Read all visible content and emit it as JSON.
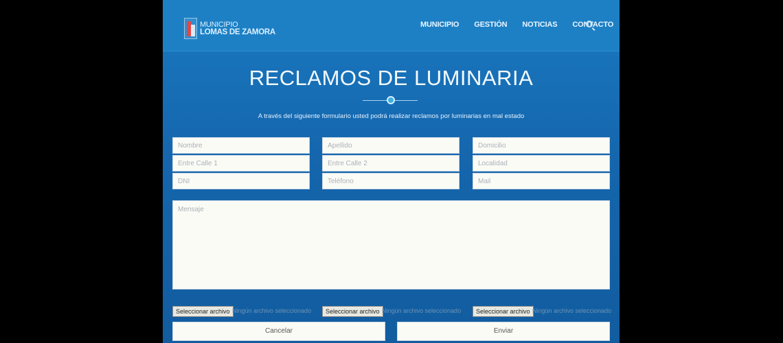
{
  "header": {
    "logo_line1": "MUNICIPIO",
    "logo_line2": "LOMAS DE ZAMORA",
    "nav": [
      "MUNICIPIO",
      "GESTIÓN",
      "NOTICIAS",
      "CONTACTO"
    ],
    "search_icon": "search-icon"
  },
  "main": {
    "title": "RECLAMOS DE LUMINARIA",
    "subtitle": "A través del siguiente formulario usted podrá realizar reclamos por luminarias en mal estado"
  },
  "form": {
    "nombre_placeholder": "Nombre",
    "apellido_placeholder": "Apellido",
    "domicilio_placeholder": "Domicilio",
    "entre_calle1_placeholder": "Entre Calle 1",
    "entre_calle2_placeholder": "Entre Calle 2",
    "localidad_placeholder": "Localidad",
    "dni_placeholder": "DNI",
    "telefono_placeholder": "Teléfono",
    "mail_placeholder": "Mail",
    "mensaje_placeholder": "Mensaje",
    "file_button_label": "Seleccionar archivo",
    "file_status": "Ningún archivo seleccionado",
    "cancel_label": "Cancelar",
    "submit_label": "Enviar"
  }
}
